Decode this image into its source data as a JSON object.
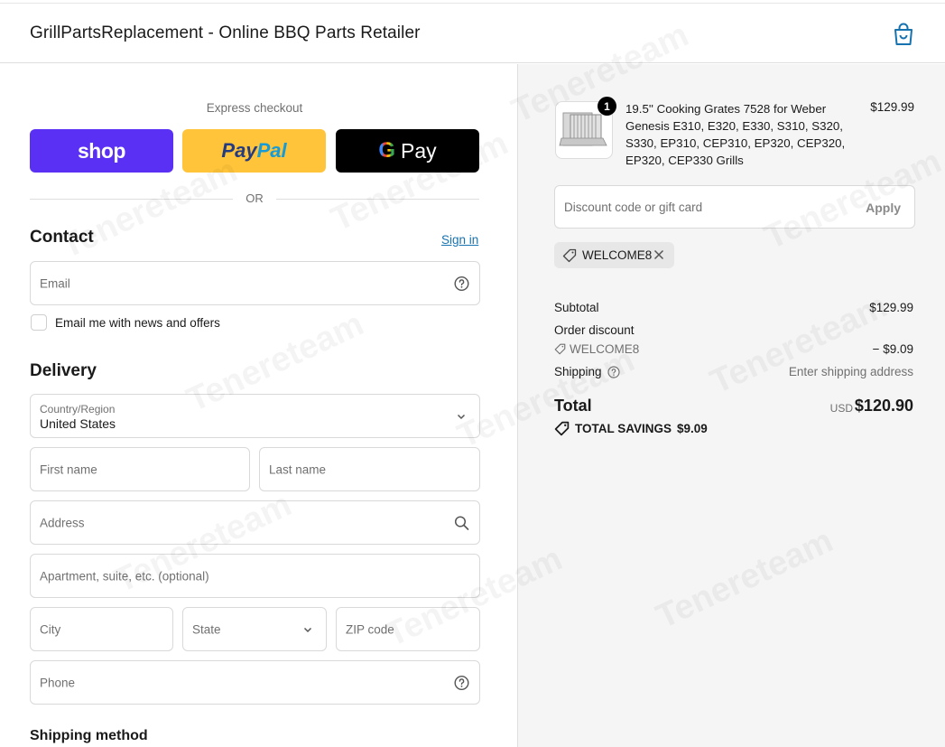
{
  "header": {
    "title": "GrillPartsReplacement - Online BBQ Parts Retailer",
    "cart_icon": "shopping-bag-icon",
    "accent_color": "#1773b0"
  },
  "express": {
    "label": "Express checkout",
    "shop_label": "shop",
    "paypal_label_1": "Pay",
    "paypal_label_2": "Pal",
    "gpay_g": "G",
    "gpay_label": "Pay",
    "or_label": "OR"
  },
  "contact": {
    "title": "Contact",
    "sign_in": "Sign in",
    "email_placeholder": "Email",
    "newsletter_label": "Email me with news and offers"
  },
  "delivery": {
    "title": "Delivery",
    "country_label": "Country/Region",
    "country_value": "United States",
    "first_name_placeholder": "First name",
    "last_name_placeholder": "Last name",
    "address_placeholder": "Address",
    "apartment_placeholder": "Apartment, suite, etc. (optional)",
    "city_placeholder": "City",
    "state_placeholder": "State",
    "zip_placeholder": "ZIP code",
    "phone_placeholder": "Phone"
  },
  "shipping_method": {
    "title": "Shipping method"
  },
  "summary": {
    "product": {
      "quantity": "1",
      "name": "19.5'' Cooking Grates 7528 for Weber Genesis E310, E320, E330, S310, S320, S330, EP310, CEP310, EP320, CEP320, EP320, CEP330 Grills",
      "price": "$129.99"
    },
    "discount_placeholder": "Discount code or gift card",
    "apply_label": "Apply",
    "applied_code": "WELCOME8",
    "subtotal_label": "Subtotal",
    "subtotal_value": "$129.99",
    "order_discount_label": "Order discount",
    "order_discount_code": "WELCOME8",
    "order_discount_value": "− $9.09",
    "shipping_label": "Shipping",
    "shipping_value": "Enter shipping address",
    "total_label": "Total",
    "total_currency": "USD",
    "total_value": "$120.90",
    "savings_label": "TOTAL SAVINGS",
    "savings_value": "$9.09"
  },
  "watermark_text": "Tenereteam"
}
